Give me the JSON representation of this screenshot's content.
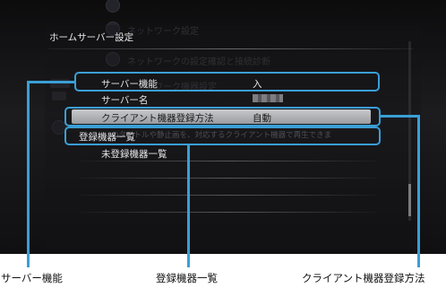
{
  "panel": {
    "title": "ホームサーバー設定"
  },
  "background_menu": {
    "items": [
      "ネットワーク設定",
      "ネットワークの設定確認と接続診断",
      "ワーク機器設定"
    ],
    "info_text": "のタイトルや静止画を、対応するクライアント機器で再生できま"
  },
  "rows": [
    {
      "label": "サーバー機能",
      "value": "入"
    },
    {
      "label": "サーバー名",
      "value": ""
    },
    {
      "label": "クライアント機器登録方法",
      "value": "自動"
    },
    {
      "label": "登録機器一覧",
      "value": ""
    },
    {
      "label": "未登録機器一覧",
      "value": ""
    }
  ],
  "callouts": {
    "server_function": "サーバー機能",
    "registered_devices": "登録機器一覧",
    "client_registration": "クライアント機器登録方法"
  },
  "colors": {
    "callout": "#3a9fd6",
    "screen_bg": "#141416",
    "selection": "#b0b2b6"
  }
}
